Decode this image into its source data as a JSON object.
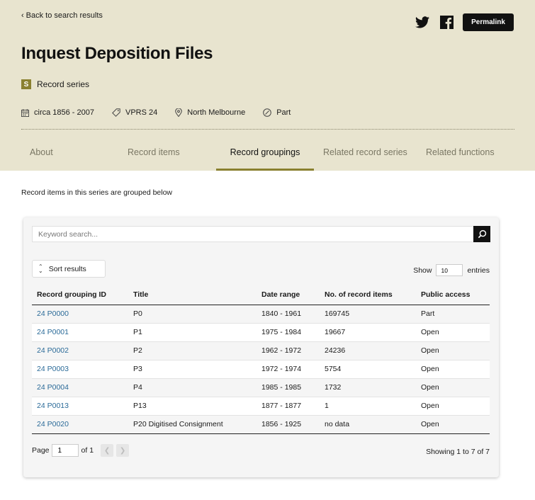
{
  "header": {
    "back_label": "Back to search results",
    "permalink_label": "Permalink",
    "title": "Inquest Deposition Files",
    "type_badge": "S",
    "type_label": "Record series",
    "meta": {
      "date": "circa 1856 - 2007",
      "series_id": "VPRS 24",
      "location": "North Melbourne",
      "status": "Part"
    },
    "tabs": [
      "About",
      "Record items",
      "Record groupings",
      "Related record series",
      "Related functions"
    ],
    "active_tab": "Record groupings"
  },
  "intro": "Record items in this series are grouped below",
  "search": {
    "placeholder": "Keyword search..."
  },
  "sort_label": "Sort results",
  "show": {
    "prefix": "Show",
    "value": "10",
    "suffix": "entries"
  },
  "table": {
    "columns": [
      "Record grouping ID",
      "Title",
      "Date range",
      "No. of record items",
      "Public access"
    ],
    "rows": [
      [
        "24 P0000",
        "P0",
        "1840 - 1961",
        "169745",
        "Part"
      ],
      [
        "24 P0001",
        "P1",
        "1975 - 1984",
        "19667",
        "Open"
      ],
      [
        "24 P0002",
        "P2",
        "1962 - 1972",
        "24236",
        "Open"
      ],
      [
        "24 P0003",
        "P3",
        "1972 - 1974",
        "5754",
        "Open"
      ],
      [
        "24 P0004",
        "P4",
        "1985 - 1985",
        "1732",
        "Open"
      ],
      [
        "24 P0013",
        "P13",
        "1877 - 1877",
        "1",
        "Open"
      ],
      [
        "24 P0020",
        "P20 Digitised Consignment",
        "1856 - 1925",
        "no data",
        "Open"
      ]
    ]
  },
  "pager": {
    "page_label": "Page",
    "page_value": "1",
    "of_label": "of 1",
    "showing": "Showing 1 to 7 of 7"
  },
  "colors": {
    "header_bg": "#e8e4cf",
    "accent": "#8a8030",
    "link": "#2a6a98"
  }
}
